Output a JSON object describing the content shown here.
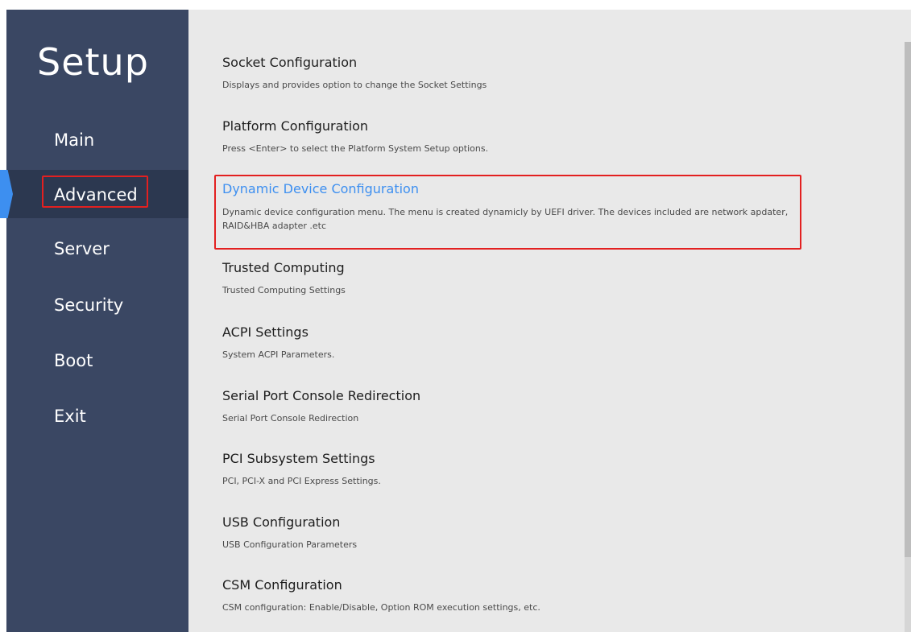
{
  "app": {
    "title": "Setup"
  },
  "colors": {
    "sidebar_bg": "#3a4763",
    "sidebar_active_bg": "#2c3850",
    "content_bg": "#e9e9e9",
    "accent": "#3d8ff0",
    "annotation_red": "#e32020"
  },
  "sidebar": {
    "items": [
      {
        "label": "Main",
        "active": false
      },
      {
        "label": "Advanced",
        "active": true
      },
      {
        "label": "Server",
        "active": false
      },
      {
        "label": "Security",
        "active": false
      },
      {
        "label": "Boot",
        "active": false
      },
      {
        "label": "Exit",
        "active": false
      }
    ],
    "active_marker_icon": "chevron-right-marker"
  },
  "main": {
    "entries": [
      {
        "title": "Socket Configuration",
        "description": "Displays and provides option to change the Socket Settings"
      },
      {
        "title": "Platform Configuration",
        "description": "Press <Enter> to select the Platform System Setup options."
      },
      {
        "title": "Dynamic Device Configuration",
        "description": "Dynamic device configuration menu. The menu is created dynamicly by UEFI driver. The devices included are network apdater, RAID&HBA adapter .etc",
        "selected": true
      },
      {
        "title": "Trusted Computing",
        "description": "Trusted Computing Settings"
      },
      {
        "title": "ACPI Settings",
        "description": "System ACPI Parameters."
      },
      {
        "title": "Serial Port Console Redirection",
        "description": "Serial Port Console Redirection"
      },
      {
        "title": "PCI Subsystem Settings",
        "description": "PCI, PCI-X and PCI Express Settings."
      },
      {
        "title": "USB Configuration",
        "description": "USB Configuration Parameters"
      },
      {
        "title": "CSM Configuration",
        "description": "CSM configuration: Enable/Disable, Option ROM execution settings, etc."
      }
    ]
  }
}
